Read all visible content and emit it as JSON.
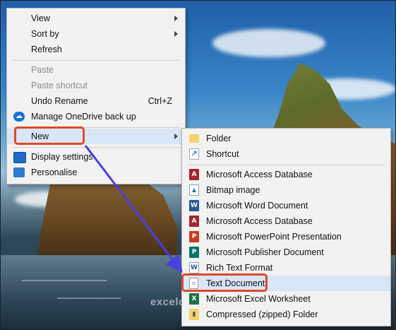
{
  "context_menu": {
    "items": [
      {
        "label": "View",
        "submenu": true
      },
      {
        "label": "Sort by",
        "submenu": true
      },
      {
        "label": "Refresh"
      },
      {
        "label": "Paste",
        "disabled": true
      },
      {
        "label": "Paste shortcut",
        "disabled": true
      },
      {
        "label": "Undo Rename",
        "shortcut": "Ctrl+Z"
      },
      {
        "label": "Manage OneDrive back up",
        "icon": "onedrive-cloud-icon"
      },
      {
        "label": "New",
        "submenu": true
      },
      {
        "label": "Display settings",
        "icon": "display-icon"
      },
      {
        "label": "Personalise",
        "icon": "personalise-icon"
      }
    ]
  },
  "new_submenu": {
    "items": [
      {
        "label": "Folder",
        "icon": "folder-icon"
      },
      {
        "label": "Shortcut",
        "icon": "shortcut-icon"
      },
      {
        "label": "Microsoft Access Database",
        "icon": "access-icon"
      },
      {
        "label": "Bitmap image",
        "icon": "bitmap-icon"
      },
      {
        "label": "Microsoft Word Document",
        "icon": "word-icon"
      },
      {
        "label": "Microsoft Access Database",
        "icon": "access-icon"
      },
      {
        "label": "Microsoft PowerPoint Presentation",
        "icon": "powerpoint-icon"
      },
      {
        "label": "Microsoft Publisher Document",
        "icon": "publisher-icon"
      },
      {
        "label": "Rich Text Format",
        "icon": "rtf-icon"
      },
      {
        "label": "Text Document",
        "icon": "text-document-icon"
      },
      {
        "label": "Microsoft Excel Worksheet",
        "icon": "excel-icon"
      },
      {
        "label": "Compressed (zipped) Folder",
        "icon": "zip-folder-icon"
      }
    ]
  },
  "colors": {
    "callout": "#e0482a",
    "arrow": "#4a3fe0",
    "menu_bg": "#f2f2f2"
  },
  "watermark": "exceldemy"
}
